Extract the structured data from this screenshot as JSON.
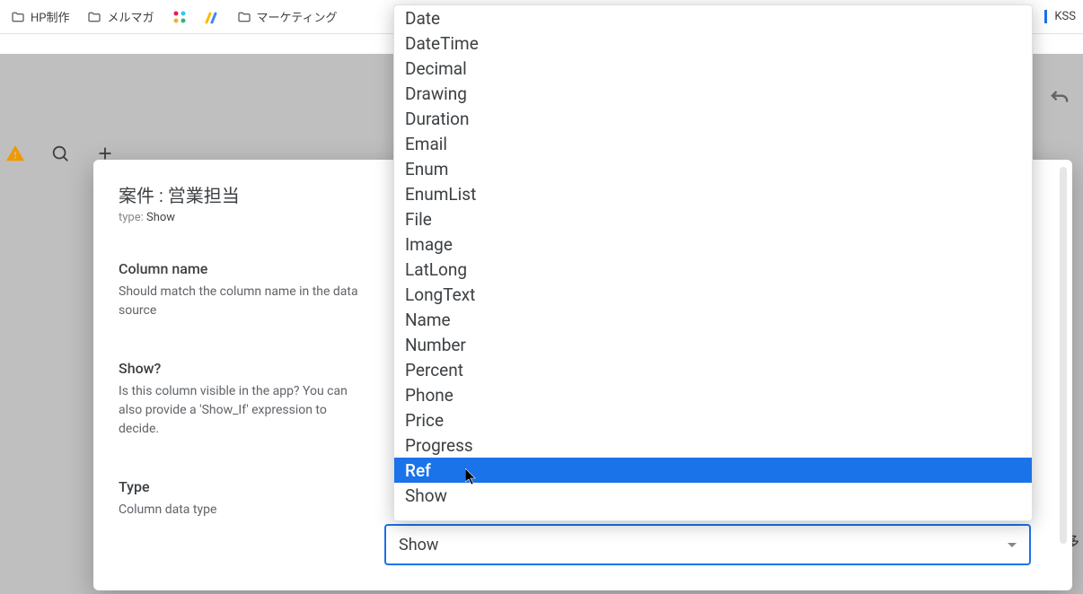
{
  "bookmarks": {
    "hp": "HP制作",
    "mailmag": "メルマガ",
    "marketing": "マーケティング",
    "kss": "KSS"
  },
  "new_label": "New",
  "dialog": {
    "title": "案件 : 営業担当",
    "type_prefix": "type:",
    "type_value": "Show",
    "field_colname_label": "Column name",
    "field_colname_desc": "Should match the column name in the data source",
    "field_show_label": "Show?",
    "field_show_desc": "Is this column visible in the app? You can also provide a 'Show_If' expression to decide.",
    "field_type_label": "Type",
    "field_type_desc": "Column data type",
    "select_value": "Show"
  },
  "dropdown": {
    "options": [
      "Date",
      "DateTime",
      "Decimal",
      "Drawing",
      "Duration",
      "Email",
      "Enum",
      "EnumList",
      "File",
      "Image",
      "LatLong",
      "LongText",
      "Name",
      "Number",
      "Percent",
      "Phone",
      "Price",
      "Progress",
      "Ref",
      "Show"
    ],
    "highlighted_index": 18
  },
  "right_text": "多"
}
